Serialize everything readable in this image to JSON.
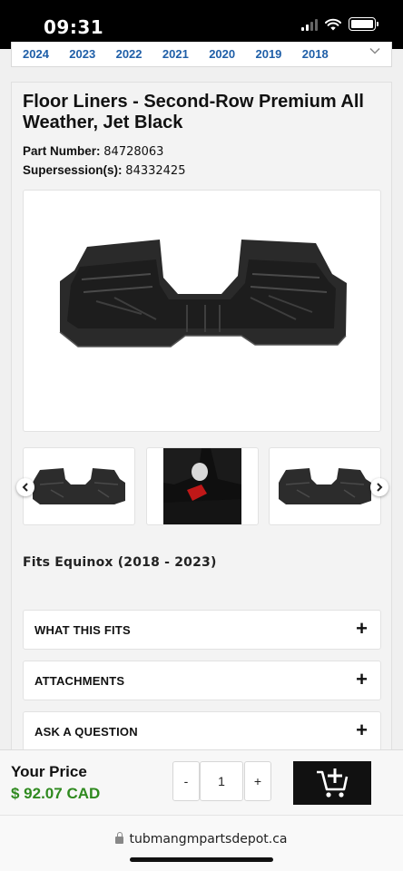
{
  "status": {
    "time": "09:31"
  },
  "years": [
    "2024",
    "2023",
    "2022",
    "2021",
    "2020",
    "2019",
    "2018"
  ],
  "product": {
    "title": "Floor Liners - Second-Row Premium All Weather, Jet Black",
    "part_number_label": "Part Number:",
    "part_number": "84728063",
    "supersession_label": "Supersession(s):",
    "supersession": "84332425",
    "fits": "Fits Equinox (2018 - 2023)"
  },
  "accordions": [
    {
      "label": "WHAT THIS FITS"
    },
    {
      "label": "ATTACHMENTS"
    },
    {
      "label": "ASK A QUESTION"
    }
  ],
  "purchase": {
    "price_label": "Your Price",
    "price": "$ 92.07 CAD",
    "qty_minus": "-",
    "qty_value": "1",
    "qty_plus": "+"
  },
  "browser": {
    "url": "tubmangmpartsdepot.ca"
  },
  "icons": {
    "prev": "chevron-left-icon",
    "next": "chevron-right-icon",
    "expand": "plus-icon",
    "cart": "add-to-cart-icon",
    "lock": "lock-icon"
  },
  "colors": {
    "price": "#2f8a1f",
    "year_link": "#1f5fa8",
    "cart_bg": "#111111"
  }
}
